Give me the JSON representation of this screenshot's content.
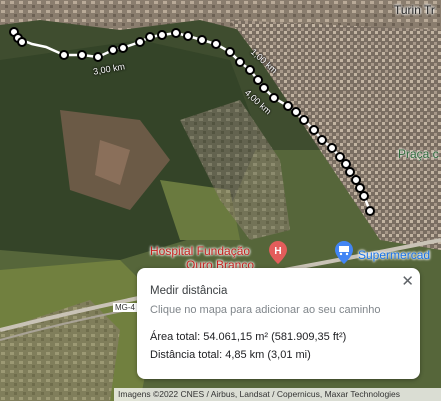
{
  "map": {
    "labels": {
      "turin": "Turin Tr",
      "praca": "Praça c",
      "hospital_line1": "Hospital Fundação",
      "hospital_line2": "Ouro Branco",
      "supermarket": "Supermercad",
      "road": "MG-4",
      "dist_3km": "3,00 km",
      "dist_1km": "1,00 km",
      "dist_4km": "4,00 km"
    },
    "icons": [
      "hospital-pin-icon",
      "supermarket-pin-icon"
    ]
  },
  "panel": {
    "title": "Medir distância",
    "hint": "Clique no mapa para adicionar ao seu caminho",
    "area": "Área total: 54.061,15 m² (581.909,35 ft²)",
    "distance": "Distância total: 4,85 km (3,01 mi)",
    "close": "✕"
  },
  "attribution": "Imagens ©2022 CNES / Airbus, Landsat / Copernicus, Maxar Technologies"
}
